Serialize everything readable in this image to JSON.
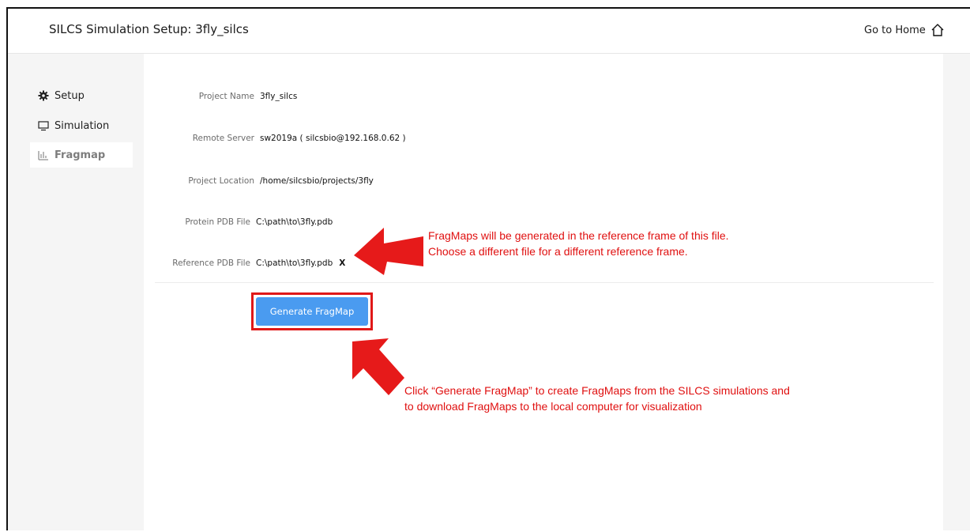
{
  "header": {
    "title": "SILCS Simulation Setup: 3fly_silcs",
    "home_label": "Go to Home"
  },
  "sidebar": {
    "items": [
      {
        "label": "Setup",
        "icon": "gear-icon"
      },
      {
        "label": "Simulation",
        "icon": "monitor-icon"
      },
      {
        "label": "Fragmap",
        "icon": "bar-chart-icon",
        "active": true
      }
    ]
  },
  "form": {
    "project_name": {
      "label": "Project Name",
      "value": "3fly_silcs"
    },
    "remote_server": {
      "label": "Remote Server",
      "value": "sw2019a ( silcsbio@192.168.0.62 )"
    },
    "project_location": {
      "label": "Project Location",
      "value": "/home/silcsbio/projects/3fly"
    },
    "protein_pdb": {
      "label": "Protein PDB File",
      "value": "C:\\path\\to\\3fly.pdb"
    },
    "reference_pdb": {
      "label": "Reference PDB File",
      "value": "C:\\path\\to\\3fly.pdb",
      "remove": "X"
    }
  },
  "actions": {
    "generate_label": "Generate FragMap"
  },
  "annotations": {
    "reference": {
      "line1": "FragMaps will be generated in the reference frame of this file.",
      "line2": "Choose a different file for a different reference frame."
    },
    "generate": {
      "line1": "Click “Generate FragMap” to create FragMaps from the SILCS  simulations and",
      "line2": "to download FragMaps to the local computer for visualization"
    }
  },
  "colors": {
    "accent": "#4a9bf0",
    "annotation": "#e01010",
    "sidebar_bg": "#f5f5f5"
  }
}
